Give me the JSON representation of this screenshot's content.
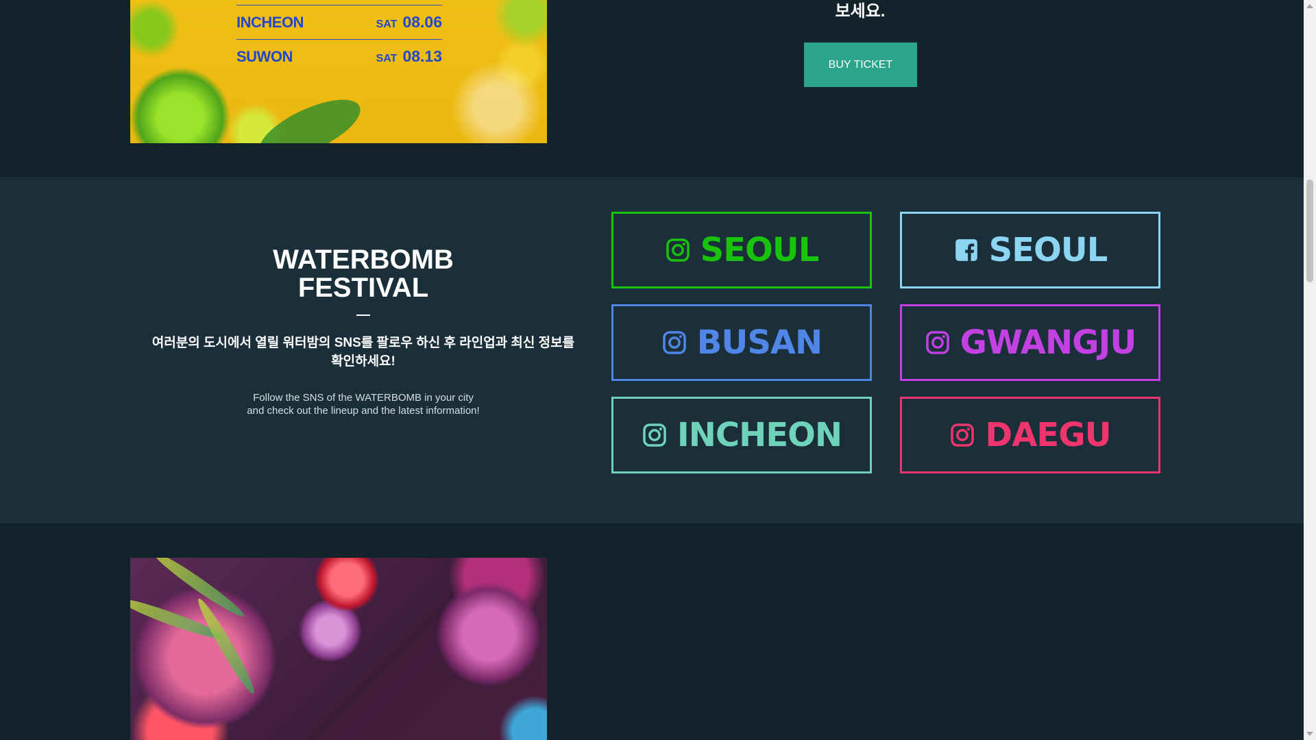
{
  "top": {
    "poster_rows": [
      {
        "city": "INCHEON",
        "day": "SAT",
        "date": "08.06"
      },
      {
        "city": "SUWON",
        "day": "SAT",
        "date": "08.13"
      }
    ],
    "heading_tail": "보세요.",
    "buy_label": "BUY TICKET"
  },
  "sns": {
    "title_line1": "WATERBOMB",
    "title_line2": "FESTIVAL",
    "korean_text": "여러분의 도시에서 열릴 워터밤의 SNS를 팔로우 하신 후 라인업과 최신 정보를 확인하세요!",
    "english_text": "Follow the SNS of the WATERBOMB in your city and check out the lineup and the latest information!",
    "buttons": [
      {
        "label": "SEOUL",
        "icon": "instagram-icon",
        "color": "#19c30c"
      },
      {
        "label": "SEOUL",
        "icon": "facebook-icon",
        "color": "#8bd4f2"
      },
      {
        "label": "BUSAN",
        "icon": "instagram-icon",
        "color": "#4f86e8"
      },
      {
        "label": "GWANGJU",
        "icon": "instagram-icon",
        "color": "#c341e3"
      },
      {
        "label": "INCHEON",
        "icon": "instagram-icon",
        "color": "#6fd2ba"
      },
      {
        "label": "DAEGU",
        "icon": "instagram-icon",
        "color": "#f0346d"
      }
    ]
  },
  "colors": {
    "background": "#13232b",
    "sns_background": "#1a2f39",
    "button_teal": "#2aa58c"
  }
}
